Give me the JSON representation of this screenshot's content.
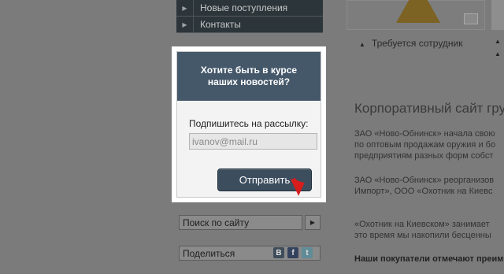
{
  "nav": {
    "items": [
      {
        "label": "Новые поступления"
      },
      {
        "label": "Контакты"
      }
    ]
  },
  "job": {
    "label": "Требуется сотрудник"
  },
  "article": {
    "title": "Корпоративный сайт гру",
    "paragraphs": [
      "ЗАО «Ново-Обнинск» начала свою",
      "по оптовым продажам оружия и бо",
      "предприятиям разных форм собст",
      "ЗАО «Ново-Обнинск» реорганизов",
      "Импорт», ООО «Охотник на Киевс",
      "«Охотник на Киевском» занимает",
      "это время мы накопили бесценны",
      "Наши покупатели отмечают преим"
    ]
  },
  "search": {
    "placeholder": "Поиск по сайту"
  },
  "share": {
    "label": "Поделиться"
  },
  "modal": {
    "title_line1": "Хотите быть в курсе",
    "title_line2": "наших новостей?",
    "subscribe_label": "Подпишитесь на рассылку:",
    "email_value": "ivanov@mail.ru",
    "submit_label": "Отправить"
  },
  "colors": {
    "modal_header": "#45586a",
    "button": "#3c4d5e",
    "pointer": "#d81d1d"
  }
}
